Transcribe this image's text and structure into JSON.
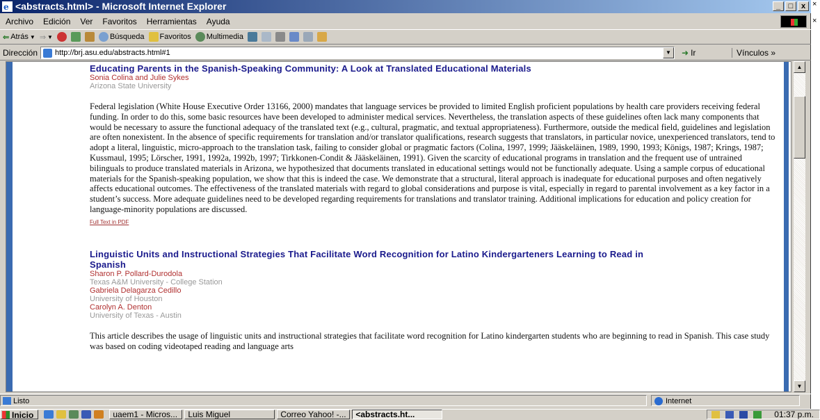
{
  "window": {
    "title": "<abstracts.html> - Microsoft Internet Explorer",
    "min": "_",
    "max": "□",
    "close": "x"
  },
  "menu": [
    "Archivo",
    "Edición",
    "Ver",
    "Favoritos",
    "Herramientas",
    "Ayuda"
  ],
  "toolbar": {
    "back": "Atrás",
    "search": "Búsqueda",
    "favorites": "Favoritos",
    "multimedia": "Multimedia"
  },
  "address": {
    "label": "Dirección",
    "url": "http://brj.asu.edu/abstracts.html#1",
    "go": "Ir",
    "links": "Vínculos »"
  },
  "articles": [
    {
      "title": "Educating Parents in the Spanish-Speaking Community: A Look at Translated Educational Materials",
      "authors": [
        {
          "name": "Sonia Colina and Julie Sykes",
          "affiliation": "Arizona State University"
        }
      ],
      "abstract": "Federal legislation (White House Executive Order 13166, 2000) mandates that language services be provided to limited English proficient populations by health care providers receiving federal funding. In order to do this, some basic resources have been developed to administer medical services. Nevertheless, the translation aspects of these guidelines often lack many components that would be necessary to assure the functional adequacy of the translated text (e.g., cultural, pragmatic, and textual appropriateness). Furthermore, outside the medical field, guidelines and legislation are often nonexistent. In the absence of specific requirements for translation and/or translator qualifications, research suggests that translators, in particular novice, unexperienced translators, tend to adopt a literal, linguistic, micro-approach to the translation task, failing to consider global or pragmatic factors (Colina, 1997, 1999; Jääskeläinen, 1989, 1990, 1993; Königs, 1987; Krings, 1987; Kussmaul, 1995; Lörscher, 1991, 1992a, 1992b, 1997; Tirkkonen-Condit & Jääskeläinen, 1991). Given the scarcity of educational programs in translation and the frequent use of untrained bilinguals to produce translated materials in Arizona, we hypothesized that documents translated in educational settings would not be functionally adequate. Using a sample corpus of educational materials for the Spanish-speaking population, we show that this is indeed the case. We demonstrate that a structural, literal approach is inadequate for educational purposes and often negatively affects educational outcomes. The effectiveness of the translated materials with regard to global considerations and purpose is vital, especially in regard to parental involvement as a key factor in a student’s success. More adequate guidelines need to be developed regarding requirements for translations and translator training. Additional implications for education and policy creation for language-minority populations are discussed.",
      "pdf": "Full Text in PDF"
    },
    {
      "title": "Linguistic Units and Instructional Strategies That Facilitate Word Recognition for Latino Kindergarteners Learning to Read in Spanish",
      "authors": [
        {
          "name": "Sharon P. Pollard-Durodola",
          "affiliation": "Texas A&M University - College Station"
        },
        {
          "name": "Gabriela Delagarza Cedillo",
          "affiliation": "University of Houston"
        },
        {
          "name": "Carolyn A. Denton",
          "affiliation": "University of Texas - Austin"
        }
      ],
      "abstract": "This article describes the usage of linguistic units and instructional strategies that facilitate word recognition for Latino kindergarten students who are beginning to read in Spanish. This case study was based on coding videotaped reading and language arts"
    }
  ],
  "status": {
    "text": "Listo",
    "zone": "Internet"
  },
  "taskbar": {
    "start": "Inicio",
    "tasks": [
      "uaem1 - Micros...",
      "Luis Miguel",
      "Correo Yahoo! -...",
      "<abstracts.ht..."
    ],
    "clock": "01:37 p.m."
  }
}
